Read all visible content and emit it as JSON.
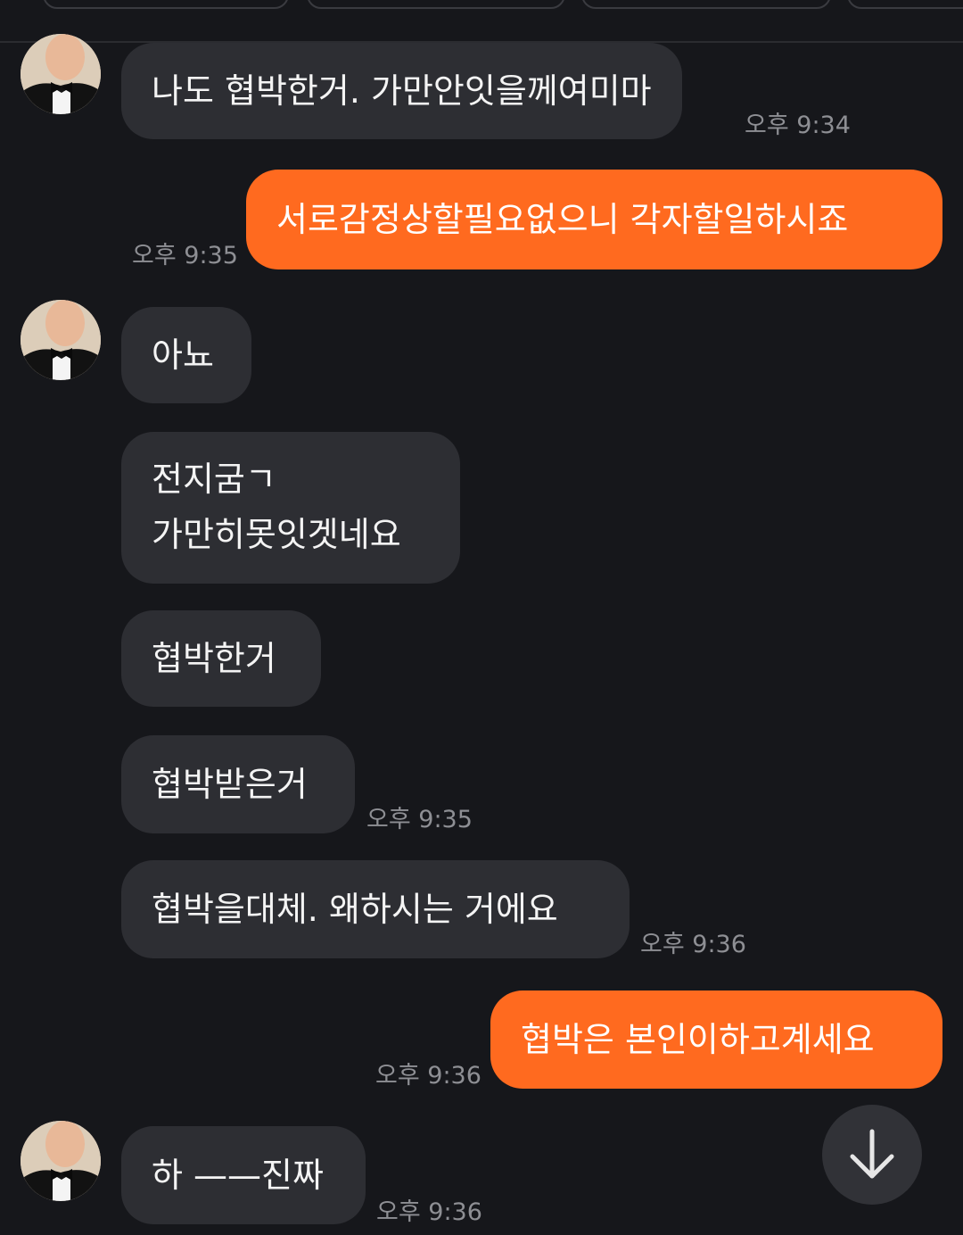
{
  "messages": [
    {
      "side": "in",
      "text": "나도 협박한거. 가만안잇을께여미마",
      "time": "오후 9:34"
    },
    {
      "side": "out",
      "text": "서로감정상할필요없으니 각자할일하시죠",
      "time": "오후 9:35"
    },
    {
      "side": "in",
      "text": "아뇨",
      "time": ""
    },
    {
      "side": "in",
      "text": "전지굼ㄱ\n가만히못잇겟네요",
      "time": ""
    },
    {
      "side": "in",
      "text": "협박한거",
      "time": ""
    },
    {
      "side": "in",
      "text": "협박받은거",
      "time": "오후 9:35"
    },
    {
      "side": "in",
      "text": "협박을대체. 왜하시는 거에요",
      "time": "오후 9:36"
    },
    {
      "side": "out",
      "text": "협박은 본인이하고계세요",
      "time": "오후 9:36"
    },
    {
      "side": "in",
      "text": "하 ——진짜",
      "time": "오후 9:36"
    }
  ],
  "scroll_button": {
    "icon": "arrow-down-icon"
  },
  "colors": {
    "background": "#16171b",
    "incoming_bubble": "#2d2e33",
    "outgoing_bubble": "#ff6a1f",
    "timestamp": "#8e8f94"
  }
}
